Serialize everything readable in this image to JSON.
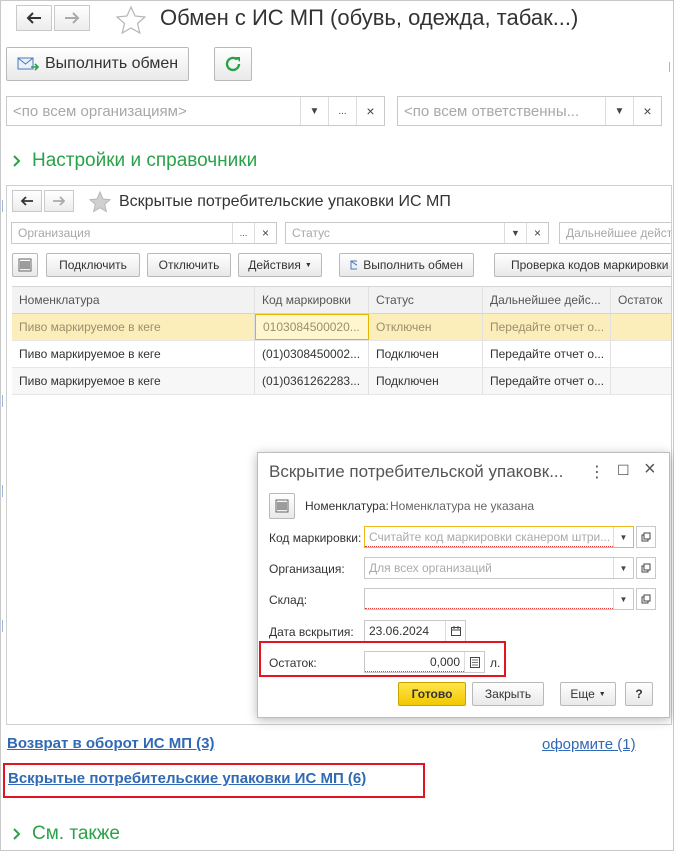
{
  "window": {
    "title": "Обмен с ИС МП (обувь, одежда, табак...)",
    "exchange_btn": "Выполнить обмен",
    "org_filter_placeholder": "<по всем организациям>",
    "resp_filter_placeholder": "<по всем ответственны...",
    "dots": "...",
    "clear": "×",
    "dropdown": "▼"
  },
  "sections": {
    "settings": "Настройки и справочники",
    "see_also": "См. также"
  },
  "inner": {
    "title": "Вскрытые потребительские упаковки ИС МП",
    "filters": {
      "org": "Организация",
      "status": "Статус",
      "further": "Дальнейшее действ..."
    },
    "toolbar": {
      "connect": "Подключить",
      "disconnect": "Отключить",
      "actions": "Действия",
      "exchange": "Выполнить обмен",
      "check": "Проверка кодов маркировки"
    },
    "columns": [
      "Номенклатура",
      "Код маркировки",
      "Статус",
      "Дальнейшее дейс...",
      "Остаток"
    ],
    "rows": [
      {
        "nom": "Пиво маркируемое в кеге",
        "code": "0103084500020...",
        "status": "Отключен",
        "action": "Передайте отчет о...",
        "rest": ""
      },
      {
        "nom": "Пиво маркируемое в кеге",
        "code": "(01)0308450002...",
        "status": "Подключен",
        "action": "Передайте отчет о...",
        "rest": ""
      },
      {
        "nom": "Пиво маркируемое в кеге",
        "code": "(01)0361262283...",
        "status": "Подключен",
        "action": "Передайте отчет о...",
        "rest": ""
      }
    ]
  },
  "dialog": {
    "title": "Вскрытие потребительской упаковк...",
    "menu": "⋮",
    "max": "☐",
    "close": "×",
    "nom_label": "Номенклатура:",
    "nom_value": "Номенклатура не указана",
    "code_label": "Код маркировки:",
    "code_placeholder": "Считайте код маркировки сканером штри...",
    "org_label": "Организация:",
    "org_placeholder": "Для всех организаций",
    "stock_label": "Склад:",
    "stock_value": "",
    "date_label": "Дата вскрытия:",
    "date_value": "23.06.2024",
    "rest_label": "Остаток:",
    "rest_value": "0,000",
    "unit": "л.",
    "ok": "Готово",
    "close_btn": "Закрыть",
    "more": "Еще",
    "help": "?"
  },
  "links": {
    "return": "Возврат в оборот ИС МП (3)",
    "fill": "оформите (1)",
    "opened": "Вскрытые потребительские упаковки ИС МП (6)"
  },
  "colors": {
    "accent_green": "#2aa24a",
    "link_blue": "#3069b4",
    "highlight_red": "#e1141f",
    "primary_yellow": "#f2c800"
  }
}
